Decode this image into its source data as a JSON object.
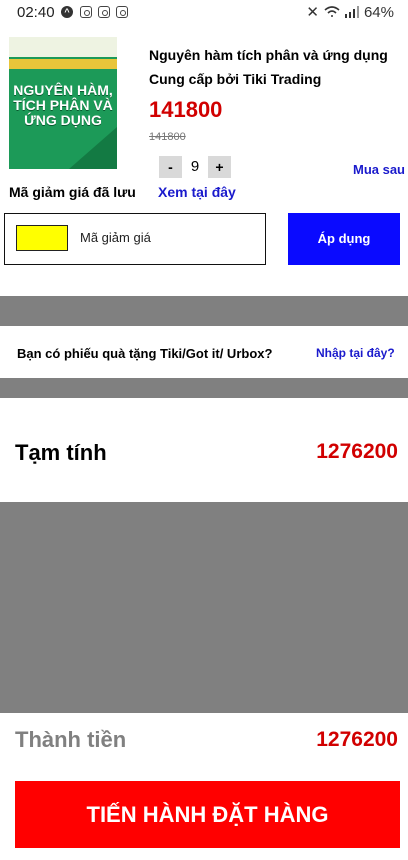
{
  "status_bar": {
    "time": "02:40",
    "battery": "64%"
  },
  "product": {
    "title": "Nguyên hàm tích phân và ứng dụng",
    "seller": "Cung cấp bởi Tiki Trading",
    "price": "141800",
    "old_price": "141800",
    "quantity": "9",
    "qty_minus": "-",
    "qty_plus": "+",
    "buy_later": "Mua sau",
    "cover_title": "NGUYÊN HÀM, TÍCH PHÂN VÀ ỨNG DỤNG"
  },
  "coupon": {
    "saved_label": "Mã giảm giá đã lưu",
    "saved_link": "Xem tại đây",
    "input_label": "Mã giảm giá",
    "apply_label": "Áp dụng"
  },
  "gift": {
    "question": "Bạn có phiếu quà tặng Tiki/Got it/ Urbox?",
    "link": "Nhập tại đây?"
  },
  "summary": {
    "subtotal_label": "Tạm tính",
    "subtotal_value": "1276200",
    "total_label": "Thành tiền",
    "total_value": "1276200"
  },
  "checkout": {
    "button_label": "TIẾN HÀNH ĐẶT HÀNG"
  },
  "colors": {
    "price_red": "#d10000",
    "link_blue": "#1a1acc",
    "apply_blue": "#0a0aff",
    "checkout_red": "#ff0000",
    "coupon_yellow": "#ffff00",
    "separator_gray": "#808080"
  }
}
